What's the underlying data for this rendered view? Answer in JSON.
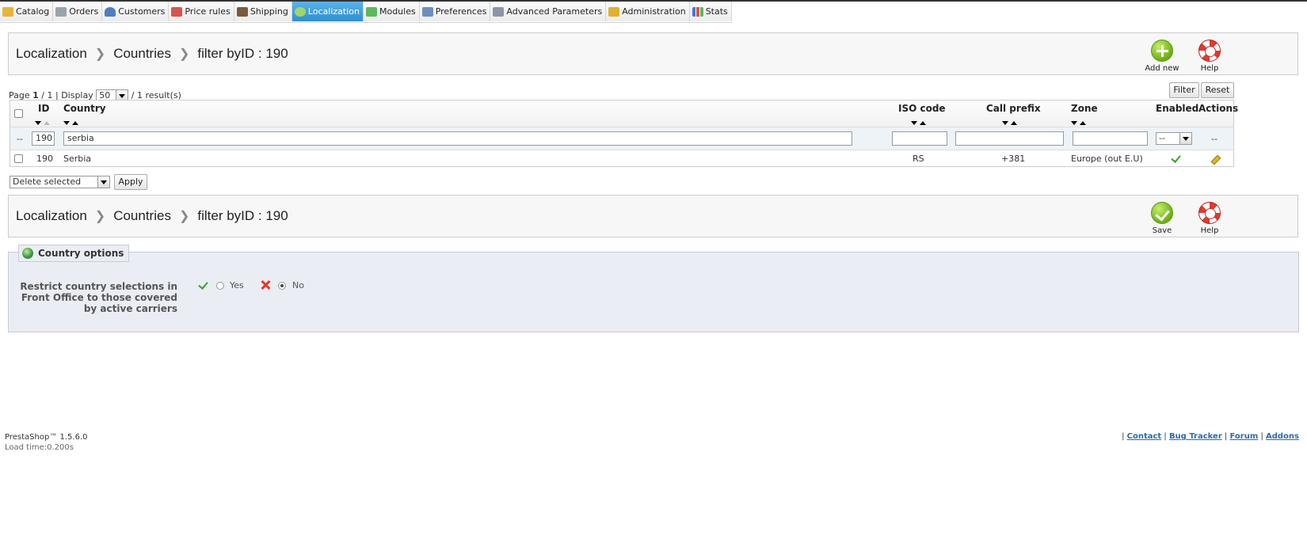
{
  "menu": {
    "items": [
      {
        "label": "Catalog",
        "icon": "folder-icon",
        "active": false
      },
      {
        "label": "Orders",
        "icon": "cart-icon",
        "active": false
      },
      {
        "label": "Customers",
        "icon": "user-icon",
        "active": false
      },
      {
        "label": "Price rules",
        "icon": "price-tag-icon",
        "active": false
      },
      {
        "label": "Shipping",
        "icon": "truck-icon",
        "active": false
      },
      {
        "label": "Localization",
        "icon": "globe-icon",
        "active": true
      },
      {
        "label": "Modules",
        "icon": "puzzle-icon",
        "active": false
      },
      {
        "label": "Preferences",
        "icon": "preferences-icon",
        "active": false
      },
      {
        "label": "Advanced Parameters",
        "icon": "wrench-icon",
        "active": false
      },
      {
        "label": "Administration",
        "icon": "key-icon",
        "active": false
      },
      {
        "label": "Stats",
        "icon": "bar-chart-icon",
        "active": false
      }
    ]
  },
  "toolbar_top": {
    "crumbs": [
      "Localization",
      "Countries",
      "filter byID : 190"
    ],
    "add_new_label": "Add new",
    "help_label": "Help"
  },
  "pagination": {
    "page_label": "Page",
    "page": "1",
    "of": "/ 1 | Display",
    "display": "50",
    "results": "/ 1 result(s)"
  },
  "filter_buttons": {
    "filter": "Filter",
    "reset": "Reset"
  },
  "table": {
    "headers": {
      "id": "ID",
      "country": "Country",
      "iso": "ISO code",
      "call": "Call prefix",
      "zone": "Zone",
      "enabled": "Enabled",
      "actions": "Actions"
    },
    "filters": {
      "dash": "--",
      "id": "190",
      "country": "serbia",
      "iso": "",
      "call": "",
      "zone": "",
      "enabled": "--",
      "actions": "--"
    },
    "rows": [
      {
        "id": "190",
        "country": "Serbia",
        "iso": "RS",
        "call": "+381",
        "zone": "Europe (out E.U)"
      }
    ]
  },
  "bulk": {
    "select": "Delete selected",
    "apply": "Apply"
  },
  "toolbar_bottom": {
    "crumbs": [
      "Localization",
      "Countries",
      "filter byID : 190"
    ],
    "save_label": "Save",
    "help_label": "Help"
  },
  "options": {
    "legend": "Country options",
    "label": "Restrict country selections in Front Office to those covered by active carriers",
    "yes": "Yes",
    "no": "No",
    "selected": "No"
  },
  "footer": {
    "version": "PrestaShop™ 1.5.6.0",
    "load_time": "Load time:0.200s",
    "links": [
      "Contact",
      "Bug Tracker",
      "Forum",
      "Addons"
    ]
  },
  "colors": {
    "active_tab": "#3a9be0",
    "success": "#39a02a",
    "danger": "#e23a2a",
    "link": "#2a6bb0"
  }
}
